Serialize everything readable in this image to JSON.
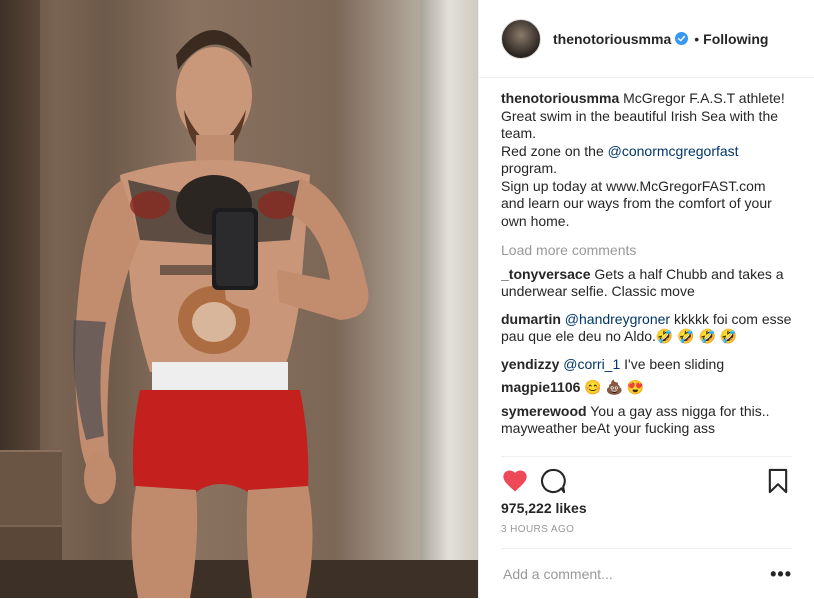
{
  "post": {
    "username": "thenotoriousmma",
    "verified": true,
    "follow_status": "Following",
    "separator": "•"
  },
  "caption": {
    "username": "thenotoriousmma",
    "line1": "McGregor F.A.S.T athlete!",
    "line2": "Great swim in the beautiful Irish Sea with the team.",
    "line3_pre": "Red zone on the ",
    "line3_mention": "@conormcgregorfast",
    "line3_post": " program.",
    "line4": "Sign up today at www.McGregorFAST.com and learn our ways from the comfort of your own home."
  },
  "load_more": "Load more comments",
  "comments": [
    {
      "user": "_tonyversace",
      "text": "Gets a half Chubb and takes a underwear selfie. Classic move"
    },
    {
      "user": "dumartin",
      "mention": "@handreygroner",
      "text": " kkkkk foi com esse pau que ele deu no Aldo.🤣 🤣 🤣 🤣"
    },
    {
      "user": "yendizzy",
      "mention": "@corri_1",
      "text": " I've been sliding"
    },
    {
      "user": "magpie1106",
      "text": "😊 💩 😍"
    },
    {
      "user": "symerewood",
      "text": "You a gay ass nigga for this.. mayweather beAt your fucking ass"
    }
  ],
  "likes": "975,222 likes",
  "time_ago": "3 HOURS AGO",
  "add_comment_placeholder": "Add a comment...",
  "more_label": "•••",
  "icons": {
    "like": "heart-icon",
    "comment": "comment-icon",
    "save": "bookmark-icon",
    "verified": "verified-badge-icon"
  },
  "colors": {
    "heart": "#ed4956",
    "verified": "#3897f0",
    "link": "#003569",
    "muted": "#999999"
  }
}
